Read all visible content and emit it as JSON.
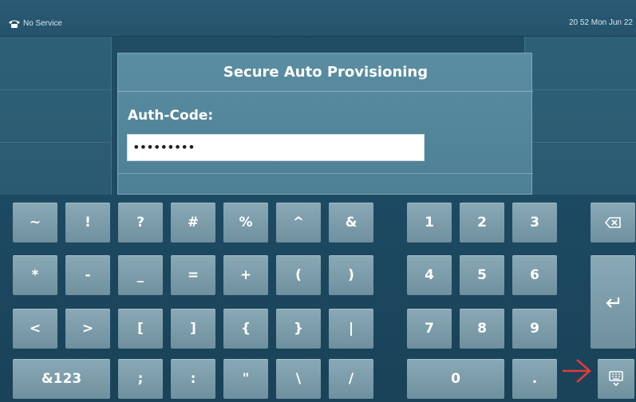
{
  "status_bar": {
    "service_text": "No Service",
    "datetime": "20 52 Mon Jun 22"
  },
  "dialog": {
    "title": "Secure Auto Provisioning",
    "field_label": "Auth-Code:",
    "field_value": "•••••••••"
  },
  "keyboard": {
    "row1": [
      "~",
      "!",
      "?",
      "#",
      "%",
      "^",
      "&"
    ],
    "row2": [
      "*",
      "-",
      "_",
      "=",
      "+",
      "(",
      ")"
    ],
    "row3": [
      "<",
      ">",
      "[",
      "]",
      "{",
      "}",
      "|"
    ],
    "row4": [
      "&123",
      ";",
      ":",
      "\"",
      "\\",
      "/"
    ],
    "numpad_row1": [
      "1",
      "2",
      "3"
    ],
    "numpad_row2": [
      "4",
      "5",
      "6"
    ],
    "numpad_row3": [
      "7",
      "8",
      "9"
    ],
    "numpad_row4": [
      "0",
      "."
    ],
    "icons": {
      "backspace": "backspace-icon",
      "enter": "enter-icon",
      "hide_keyboard": "keyboard-hide-icon",
      "annotation_arrow": "red-arrow-icon"
    }
  },
  "colors": {
    "annotation_arrow": "#e53a3a",
    "key_fill": "#7c9dab",
    "dialog_fill": "#55879b"
  }
}
